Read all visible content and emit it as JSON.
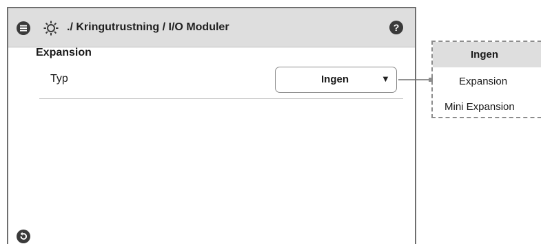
{
  "header": {
    "title": "./ Kringutrustning / I/O Moduler",
    "icons": {
      "menu": "menu-icon",
      "settings": "gear-icon",
      "help": "help-icon"
    },
    "background": "#dedede"
  },
  "main": {
    "section_title": "Expansion",
    "field": {
      "label": "Typ",
      "value": "Ingen"
    }
  },
  "footer": {
    "back_icon": "back-icon"
  },
  "dropdown_options": {
    "selected": "Ingen",
    "items": [
      "Ingen",
      "Expansion",
      "Mini Expansion"
    ]
  }
}
